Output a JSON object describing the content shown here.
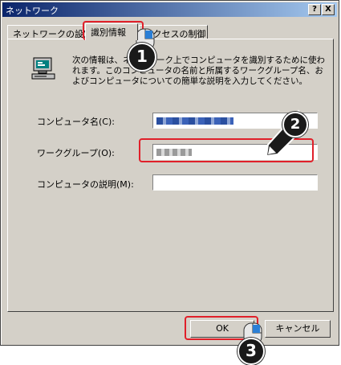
{
  "window": {
    "title": "ネットワーク",
    "help_label": "?",
    "close_label": "X"
  },
  "tabs": [
    {
      "label": "ネットワークの設定"
    },
    {
      "label": "識別情報"
    },
    {
      "label": "アクセスの制御"
    }
  ],
  "identification": {
    "description": "次の情報は、ネットワーク上でコンピュータを識別するために使われます。このコンピュータの名前と所属するワークグループ名、およびコンピュータについての簡単な説明を入力してください。",
    "computer_name_label": "コンピュータ名(C):",
    "computer_name_value": "",
    "workgroup_label": "ワークグループ(O):",
    "workgroup_value": "",
    "comment_label": "コンピュータの説明(M):",
    "comment_value": ""
  },
  "buttons": {
    "ok_label": "OK",
    "cancel_label": "キャンセル"
  },
  "annotations": {
    "step1": "1",
    "step2": "2",
    "step3": "3"
  },
  "colors": {
    "highlight": "#e0202a",
    "titlebar_start": "#0a246a",
    "titlebar_end": "#a6caf0",
    "face": "#d4d0c8"
  }
}
